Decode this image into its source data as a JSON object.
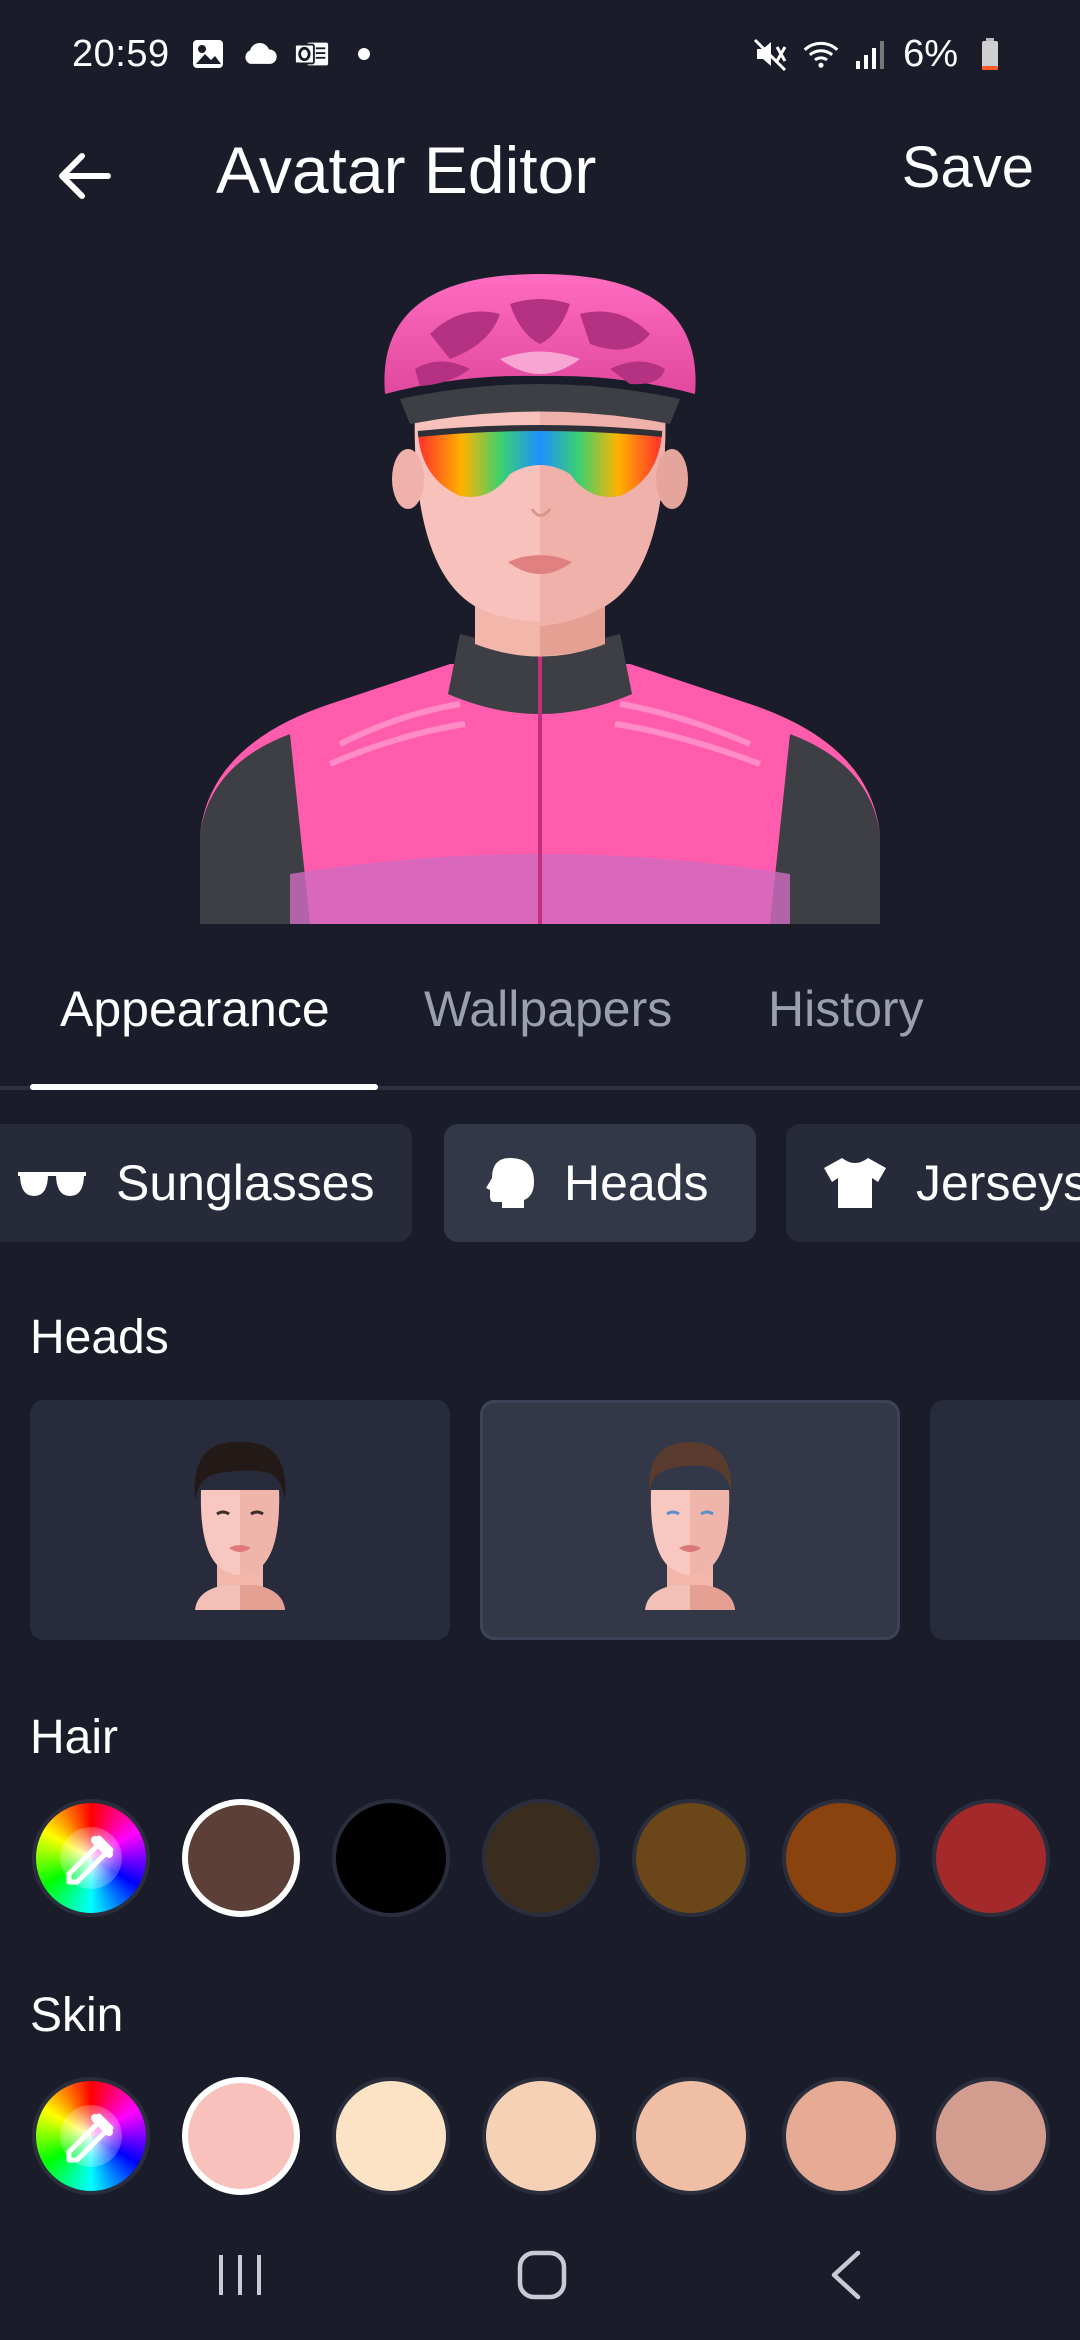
{
  "status_bar": {
    "time": "20:59",
    "battery": "6%",
    "icons": [
      "image-icon",
      "cloud-icon",
      "outlook-icon",
      "dot-icon",
      "mute-icon",
      "wifi-icon",
      "signal-icon",
      "battery-icon"
    ]
  },
  "app_bar": {
    "title": "Avatar Editor",
    "save_label": "Save",
    "back_icon": "arrow-left-icon"
  },
  "colors": {
    "background": "#1a1d29",
    "card": "#272b3b",
    "card_selected": "#333849",
    "tab_inactive": "#9aa0ae"
  },
  "tabs": [
    {
      "label": "Appearance",
      "active": true
    },
    {
      "label": "Wallpapers",
      "active": false
    },
    {
      "label": "History",
      "active": false
    }
  ],
  "categories": [
    {
      "label": "Sunglasses",
      "icon": "sunglasses-icon",
      "selected": false
    },
    {
      "label": "Heads",
      "icon": "head-icon",
      "selected": true
    },
    {
      "label": "Jerseys",
      "icon": "tshirt-icon",
      "selected": false
    }
  ],
  "sections": {
    "heads": "Heads",
    "hair": "Hair",
    "skin": "Skin"
  },
  "heads": [
    {
      "hair_color": "#231a17",
      "selected": false
    },
    {
      "hair_color": "#5a3c2e",
      "selected": true
    },
    {
      "hair_color": "",
      "selected": false
    }
  ],
  "hair_colors": [
    {
      "type": "picker",
      "icon": "eyedropper-icon"
    },
    {
      "color": "#5c3f37",
      "selected": true
    },
    {
      "color": "#000000",
      "selected": false
    },
    {
      "color": "#3a2d1d",
      "selected": false
    },
    {
      "color": "#6b4618",
      "selected": false
    },
    {
      "color": "#8a420e",
      "selected": false
    },
    {
      "color": "#a3292a",
      "selected": false
    }
  ],
  "skin_colors": [
    {
      "type": "picker",
      "icon": "eyedropper-icon"
    },
    {
      "color": "#f8c1bb",
      "selected": true
    },
    {
      "color": "#fde3c6",
      "selected": false
    },
    {
      "color": "#f6d1b5",
      "selected": false
    },
    {
      "color": "#f0bea5",
      "selected": false
    },
    {
      "color": "#e6aa95",
      "selected": false
    },
    {
      "color": "#d29d8f",
      "selected": false
    }
  ],
  "nav_bar": [
    "recents-icon",
    "home-icon",
    "back-icon"
  ]
}
